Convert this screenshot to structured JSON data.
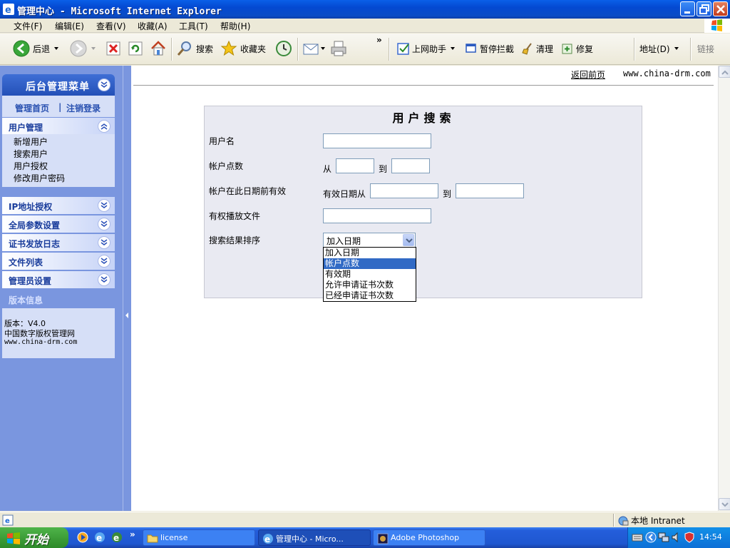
{
  "window": {
    "title": "管理中心 - Microsoft Internet Explorer"
  },
  "menubar": {
    "items": [
      "文件(F)",
      "编辑(E)",
      "查看(V)",
      "收藏(A)",
      "工具(T)",
      "帮助(H)"
    ]
  },
  "toolbar": {
    "back": "后退",
    "search": "搜索",
    "favorites": "收藏夹",
    "assistant": "上网助手",
    "popup_block": "暂停拦截",
    "clean": "清理",
    "repair": "修复",
    "address": "地址(D)",
    "links": "链接"
  },
  "sidebar": {
    "header": "后台管理菜单",
    "links": {
      "home": "管理首页",
      "divider": "|",
      "logout": "注销登录"
    },
    "user_mgmt": {
      "label": "用户管理",
      "items": [
        "新增用户",
        "搜索用户",
        "用户授权",
        "修改用户密码"
      ]
    },
    "sections": [
      "IP地址授权",
      "全局参数设置",
      "证书发放日志",
      "文件列表",
      "管理员设置"
    ],
    "version": {
      "title": "版本信息",
      "line1": "版本：V4.0",
      "line2": "中国数字版权管理网",
      "line3": "www.china-drm.com"
    }
  },
  "main": {
    "back_link": "返回前页",
    "site_url": "www.china-drm.com"
  },
  "search_form": {
    "title": "用户搜索",
    "username_label": "用户名",
    "points_label": "帐户点数",
    "points_from": "从",
    "points_to": "到",
    "valid_before_label": "帐户在此日期前有效",
    "valid_from": "有效日期从",
    "valid_to": "到",
    "file_label": "有权播放文件",
    "sort_label": "搜索结果排序",
    "sort_selected": "加入日期",
    "sort_options": [
      "加入日期",
      "帐户点数",
      "有效期",
      "允许申请证书次数",
      "已经申请证书次数"
    ],
    "sort_highlighted_index": 1
  },
  "statusbar": {
    "zone": "本地 Intranet"
  },
  "taskbar": {
    "start": "开始",
    "tasks": [
      "license",
      "管理中心 - Micro...",
      "Adobe Photoshop"
    ],
    "clock": "14:54"
  },
  "colors": {
    "sidebar_bg": "#7a96df",
    "panel_bg": "#e9eaf2",
    "highlight": "#316ac5"
  }
}
